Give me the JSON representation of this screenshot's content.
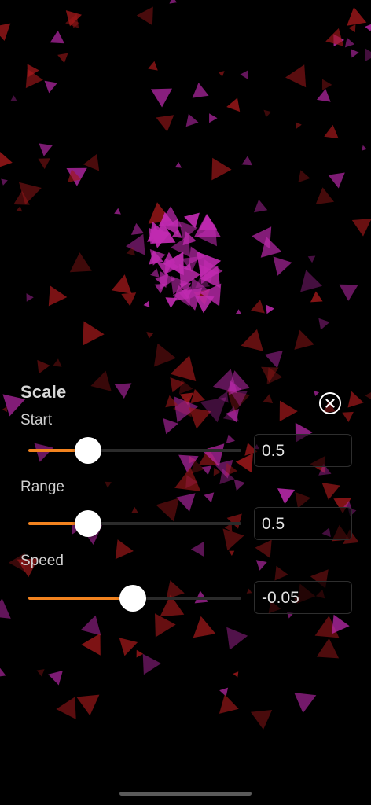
{
  "panel": {
    "title": "Scale",
    "close_icon": "close-circle-icon"
  },
  "sliders": [
    {
      "label": "Start",
      "value": "0.5",
      "fill_fraction": 0.28
    },
    {
      "label": "Range",
      "value": "0.5",
      "fill_fraction": 0.28
    },
    {
      "label": "Speed",
      "value": "-0.05",
      "fill_fraction": 0.49
    }
  ],
  "colors": {
    "slider_fill": "#f2831f",
    "slider_track": "#2b2b2b",
    "thumb": "#ffffff",
    "particle_magenta": "#c02ab0",
    "particle_red": "#a0181a",
    "background": "#000000"
  }
}
